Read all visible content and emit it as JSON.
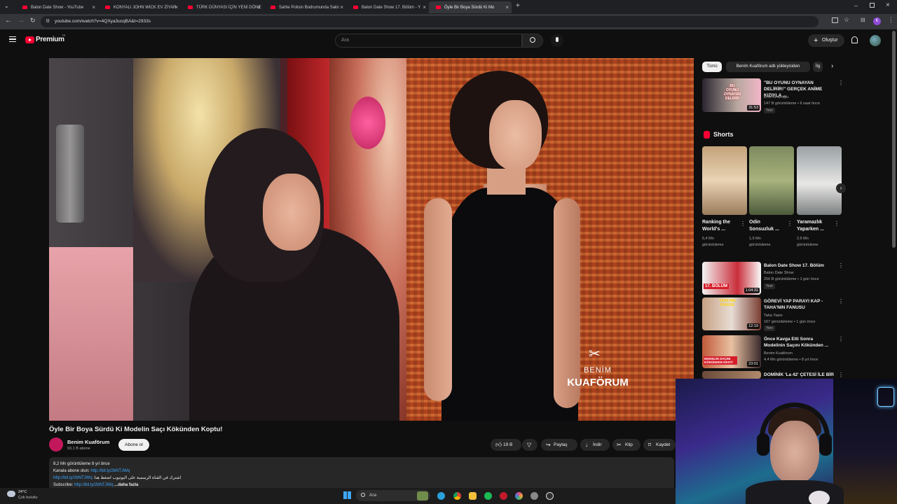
{
  "browser": {
    "tabs": [
      {
        "title": "Balon Date Show - YouTube",
        "active": false
      },
      {
        "title": "KONYALI JOHN WICK EV ZİYAR",
        "active": false
      },
      {
        "title": "TÜRK DÜNYASI İÇİN YENİ DÖNE",
        "active": false
      },
      {
        "title": "Sahte Polisin Bodrumunda Saklı",
        "active": false
      },
      {
        "title": "Balon Date Show 17. Bölüm - Y",
        "active": false
      },
      {
        "title": "Öyle Bir Boya Sürdü Ki Mo",
        "active": true
      }
    ],
    "url": "youtube.com/watch?v=4QXya3ucqBA&t=2933s"
  },
  "header": {
    "logo": "Premium",
    "logo_sup": "TR",
    "search_placeholder": "Ara",
    "create_label": "Oluştur",
    "avatar_letter": "K"
  },
  "video": {
    "title": "Öyle Bir Boya Sürdü Ki Modelin Saçı Kökünden Koptu!",
    "watermark_top": "BENİM",
    "watermark_bottom": "KUAFÖRUM",
    "channel": {
      "name": "Benim Kuaförum",
      "subs": "93,1 B abone",
      "subscribe_label": "Abone ol"
    },
    "actions": {
      "like_count": "19 B",
      "share": "Paylaş",
      "download": "İndir",
      "clip": "Klip",
      "save": "Kaydet"
    },
    "description": {
      "views_date": "8,2 Mn görüntüleme  8 yıl önce",
      "line1_label": "Kanala abone olun: ",
      "line1_link": "http://bit.ly/2bNTJWq",
      "line2_text": "اشترك في القناة الرسمية على اليوتيوب اضغط هنا: ",
      "line2_link": "http://bit.ly/2bNTJWq",
      "line3_label": "Subscribe: ",
      "line3_link": "http://bit.ly/2bNTJWq",
      "more": "...daha fazla"
    }
  },
  "sidebar": {
    "chips": [
      {
        "label": "Tümü",
        "selected": true
      },
      {
        "label": "Benim Kuaförum adlı yükleyiciden",
        "selected": false
      },
      {
        "label": "İlg",
        "selected": false
      }
    ],
    "top_video": {
      "title": "\"BU OYUNU OYNAYAN DELİRİR!\" GERÇEK ANİME KIZIYLA ...",
      "channel": "Enis Kirazoğlu",
      "meta": "147 B görüntüleme • 6 saat önce",
      "badge": "Yeni",
      "duration": "31:53",
      "thumb_text_1": "BU",
      "thumb_text_2": "OYUNU",
      "thumb_text_3": "OYNAYAN",
      "thumb_text_4": "DELİRİR"
    },
    "shorts_heading": "Shorts",
    "shorts": [
      {
        "title": "Ranking the World's ...",
        "views": "5,4 Mn görüntüleme"
      },
      {
        "title": "Odin Sonsuzluk ...",
        "views": "1,6 Mn görüntüleme"
      },
      {
        "title": "Yaramazlık Yaparken ...",
        "views": "2,6 Mn görüntüleme"
      }
    ],
    "videos": [
      {
        "title": "Balon Date Show 17. Bölüm",
        "channel": "Balon Date Show",
        "meta": "256 B görüntüleme • 1 gün önce",
        "badge": "Yeni",
        "duration": "1:04:31",
        "thumb_label": "17. BÖLÜM"
      },
      {
        "title": "GÖREVİ YAP PARAYI KAP - TAHA'NIN FANUSU",
        "channel": "Taha Yasin",
        "meta": "167 görüntüleme • 1 gün önce",
        "badge": "Yeni",
        "duration": "12:19",
        "thumb_label": "TAHA'NIN FANUSU"
      },
      {
        "title": "Önce Kavga Etti Sonra Modelinin Saçını Kökünden ...",
        "channel": "Benim Kuaförum",
        "meta": "4,4 Mn görüntüleme • 8 yıl önce",
        "badge": "",
        "duration": "23:01",
        "thumb_label": "MODELİN SAÇINI KÖKÜNDEN KESTİ"
      },
      {
        "title": "DOMİNİK 'La 42' ÇETESİ İLE BİR",
        "channel": "",
        "meta": "",
        "badge": "",
        "duration": "",
        "thumb_label": ""
      }
    ]
  },
  "taskbar": {
    "weather_temp": "24°C",
    "weather_desc": "Çok bulutlu",
    "search_label": "Ara"
  },
  "colors": {
    "yt_red": "#ff0033",
    "link": "#3ea6ff",
    "bg": "#0f0f0f",
    "chip_selected": "#f1f1f1"
  }
}
